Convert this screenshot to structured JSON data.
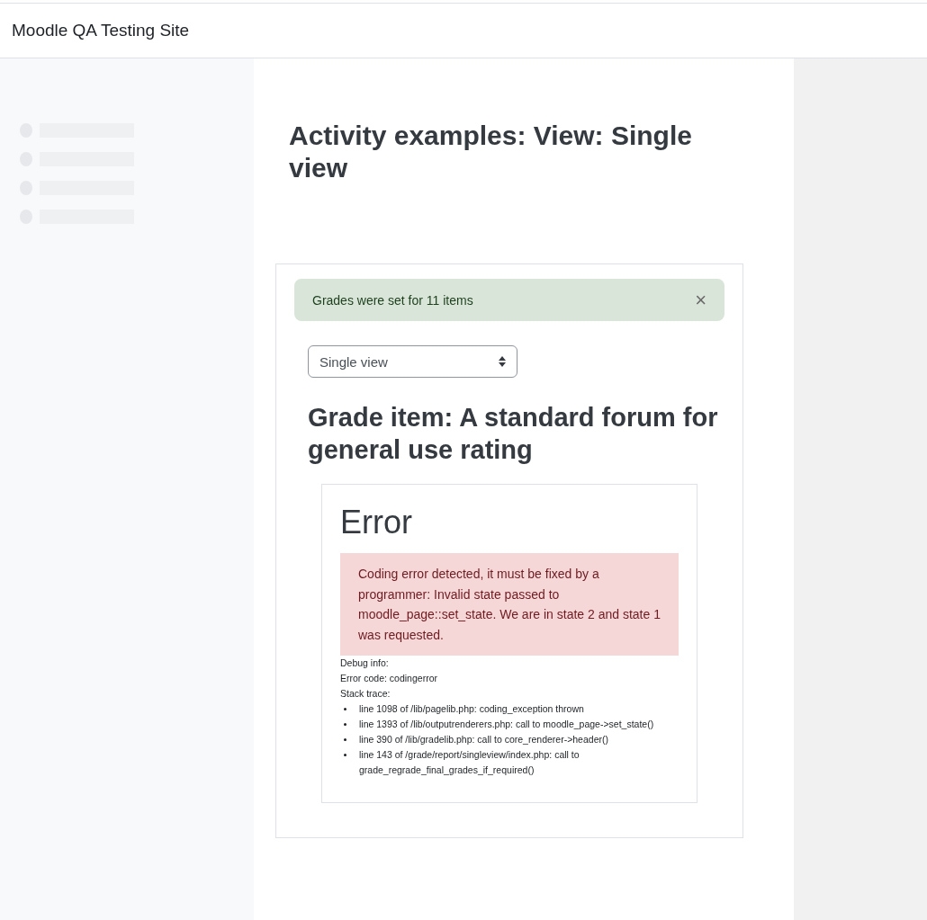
{
  "header": {
    "site_name": "Moodle QA Testing Site"
  },
  "page": {
    "title": "Activity examples: View: Single view"
  },
  "alert": {
    "message": "Grades were set for 11 items",
    "close": "×"
  },
  "view_select": {
    "value": "Single view"
  },
  "grade_heading": "Grade item: A standard forum for general use rating",
  "error": {
    "title": "Error",
    "message": "Coding error detected, it must be fixed by a programmer: Invalid state passed to moodle_page::set_state. We are in state 2 and state 1 was requested.",
    "debug_lines": [
      "Debug info:",
      "Error code: codingerror",
      "Stack trace:"
    ],
    "stack_trace": [
      "line 1098 of /lib/pagelib.php: coding_exception thrown",
      "line 1393 of /lib/outputrenderers.php: call to moodle_page->set_state()",
      "line 390 of /lib/gradelib.php: call to core_renderer->header()",
      "line 143 of /grade/report/singleview/index.php: call to grade_regrade_final_grades_if_required()"
    ]
  }
}
